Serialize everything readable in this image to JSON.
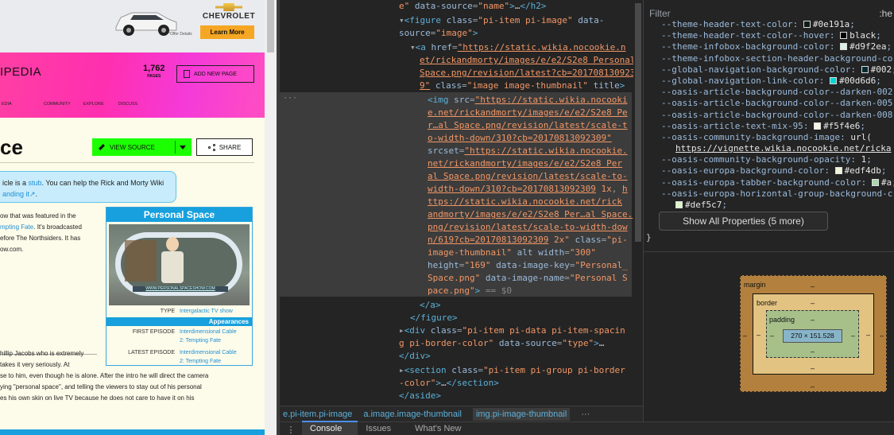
{
  "page": {
    "ad": {
      "brand": "CHEVROLET",
      "button": "Learn More",
      "offer": "*Offer Details"
    },
    "wiki_name": "IPEDIA",
    "pages_count": "1,762",
    "pages_label": "PAGES",
    "add_new_page": "ADD NEW PAGE",
    "nav": [
      "EDIA",
      "COMMUNITY",
      "EXPLORE",
      "DISCUSS"
    ],
    "title": "ce",
    "view_source": "VIEW SOURCE",
    "share": "SHARE",
    "stub_l1_pre": "icle is a ",
    "stub_link": "stub",
    "stub_l1_post": ". You can help the Rick and Morty Wiki",
    "stub_l2": "anding it",
    "body": [
      "ow that was featured in the",
      "mpting Fate",
      ". It's broadcasted",
      "efore The Northsiders. It has",
      "ow.com."
    ],
    "body2": [
      "hillip Jacobs who is extremely",
      "takes it very seriously. At",
      "se to him, even though he is alone. After the intro he will direct the camera",
      "ying \"personal space\", and telling the viewers to stay out of his personal",
      "es his own skin on live TV because he does not care to have it on his"
    ],
    "infobox": {
      "title": "Personal Space",
      "image_url": "WWW.PERSONALSPACESHOW.COM",
      "type_label": "TYPE",
      "type_value": "Intergalactic TV show",
      "appearances": "Appearances",
      "first_label": "FIRST EPISODE",
      "first_value_1": "Interdimensional Cable",
      "first_value_2": "2: Tempting Fate",
      "latest_label": "LATEST EPISODE",
      "latest_value_1": "Interdimensional Cable",
      "latest_value_2": "2: Tempting Fate"
    }
  },
  "elements": {
    "breadcrumbs": [
      "e.pi-item.pi-image",
      "a.image.image-thumbnail",
      "img.pi-image-thumbnail"
    ],
    "drawer_tabs": [
      "Console",
      "Issues",
      "What's New"
    ]
  },
  "styles": {
    "filter_placeholder": "Filter",
    "hov": ":he",
    "properties": [
      {
        "name": "--theme-header-text-color",
        "value": "#0e191a",
        "color": "#0e191a"
      },
      {
        "name": "--theme-header-text-color--hover",
        "value": "black",
        "color": "#000000"
      },
      {
        "name": "--theme-infobox-background-color",
        "value": "#d9f2ea",
        "color": "#d9f2ea"
      },
      {
        "name": "--theme-infobox-section-header-background-co",
        "value": "",
        "color": ""
      },
      {
        "name": "--global-navigation-background-color",
        "value": "#002",
        "color": "#002a32"
      },
      {
        "name": "--global-navigation-link-color",
        "value": "#00d6d6",
        "color": "#00d6d6"
      },
      {
        "name": "--oasis-article-background-color--darken-002",
        "value": "",
        "color": ""
      },
      {
        "name": "--oasis-article-background-color--darken-005",
        "value": "",
        "color": ""
      },
      {
        "name": "--oasis-article-background-color--darken-008",
        "value": "",
        "color": ""
      },
      {
        "name": "--oasis-article-text-mix-95",
        "value": "#f5f4e6",
        "color": "#f5f4e6"
      },
      {
        "name": "--oasis-community-background-image",
        "value": "url(",
        "color": ""
      },
      {
        "name": "",
        "value": "https://vignette.wikia.nocookie.net/ricka",
        "color": "",
        "link": true
      },
      {
        "name": "--oasis-community-background-opacity",
        "value": "1",
        "color": ""
      },
      {
        "name": "--oasis-europa-background-color",
        "value": "#edf4db",
        "color": "#edf4db"
      },
      {
        "name": "--oasis-europa-tabber-background-color",
        "value": "#a",
        "color": "#a8d8a8"
      },
      {
        "name": "--oasis-europa-horizontal-group-background-c",
        "value": "",
        "color": ""
      },
      {
        "name": "",
        "value": "#def5c7",
        "color": "#def5c7"
      }
    ],
    "show_all": "Show All Properties (5 more)",
    "box": {
      "margin": "margin",
      "border": "border",
      "padding": "padding",
      "content": "270 × 151.528",
      "dash": "–"
    }
  }
}
